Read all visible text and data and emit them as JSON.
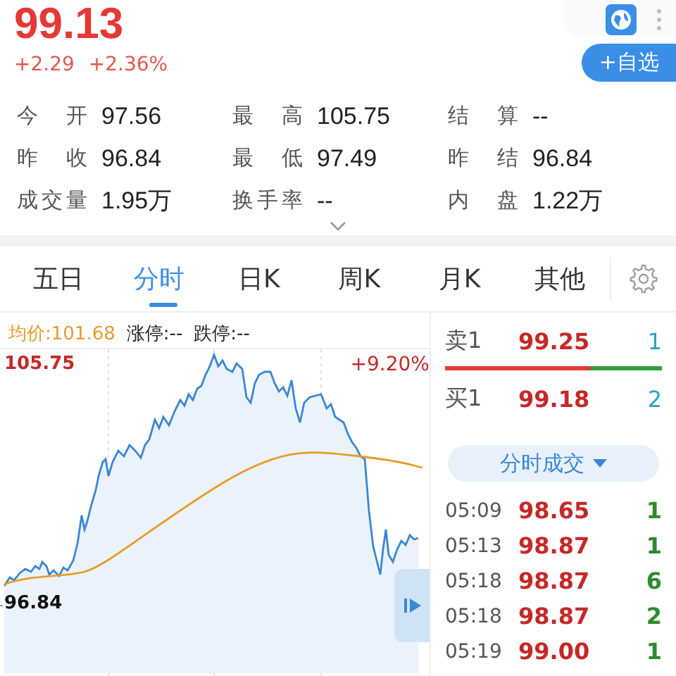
{
  "quote": {
    "price": "99.13",
    "change": "+2.29",
    "change_pct": "+2.36%"
  },
  "watchlist_button": "+自选",
  "stat_rows": [
    [
      {
        "label": "今开",
        "value": "97.56"
      },
      {
        "label": "最高",
        "value": "105.75"
      },
      {
        "label": "结算",
        "value": "--"
      }
    ],
    [
      {
        "label": "昨收",
        "value": "96.84"
      },
      {
        "label": "最低",
        "value": "97.49"
      },
      {
        "label": "昨结",
        "value": "96.84"
      }
    ],
    [
      {
        "label": "成交量",
        "value": "1.95万"
      },
      {
        "label": "换手率",
        "value": "--"
      },
      {
        "label": "内盘",
        "value": "1.22万"
      }
    ]
  ],
  "tabs": [
    {
      "label": "五日",
      "selected": false
    },
    {
      "label": "分时",
      "selected": true
    },
    {
      "label": "日K",
      "selected": false
    },
    {
      "label": "周K",
      "selected": false
    },
    {
      "label": "月K",
      "selected": false
    },
    {
      "label": "其他",
      "selected": false
    }
  ],
  "chart": {
    "avg_label": "均价:101.68",
    "limit_up": "涨停:--",
    "limit_down": "跌停:--",
    "high": "105.75",
    "high_pct": "+9.20%",
    "prev_close": "96.84"
  },
  "order_book": {
    "ask": {
      "label": "卖1",
      "price": "99.25",
      "volume": "1"
    },
    "level": 0.67,
    "bid": {
      "label": "买1",
      "price": "99.18",
      "volume": "2"
    }
  },
  "trades_button": "分时成交",
  "trades": [
    {
      "time": "05:09",
      "price": "98.65",
      "volume": "1"
    },
    {
      "time": "05:13",
      "price": "98.87",
      "volume": "1"
    },
    {
      "time": "05:18",
      "price": "98.87",
      "volume": "6"
    },
    {
      "time": "05:18",
      "price": "98.87",
      "volume": "2"
    },
    {
      "time": "05:19",
      "price": "99.00",
      "volume": "1"
    }
  ]
}
